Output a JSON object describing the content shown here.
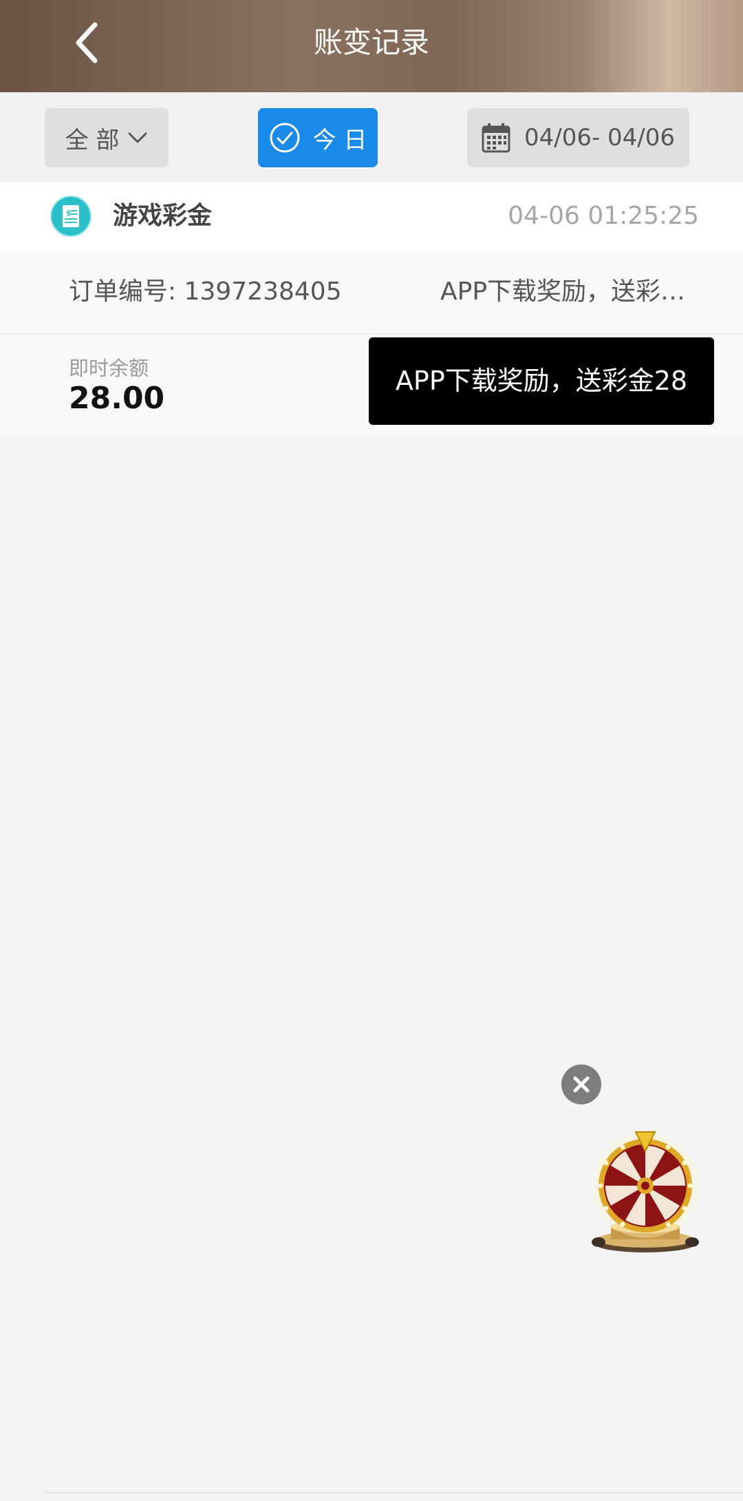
{
  "header": {
    "title": "账变记录",
    "back_icon": "chevron-left-icon"
  },
  "filters": {
    "all_label": "全 部",
    "today_label": "今 日",
    "date_range": "04/06- 04/06",
    "today_color": "#1a8ae8"
  },
  "record": {
    "type": "游戏彩金",
    "time": "04-06 01:25:25",
    "order_number": "订单编号: 1397238405",
    "description": "APP下载奖励，送彩金28",
    "balance_label": "即时余额",
    "balance_value": "28.00"
  },
  "tooltip": {
    "text": "APP下载奖励，送彩金28"
  },
  "floating": {
    "close_icon": "close-icon",
    "wheel_icon": "prize-wheel-icon"
  }
}
